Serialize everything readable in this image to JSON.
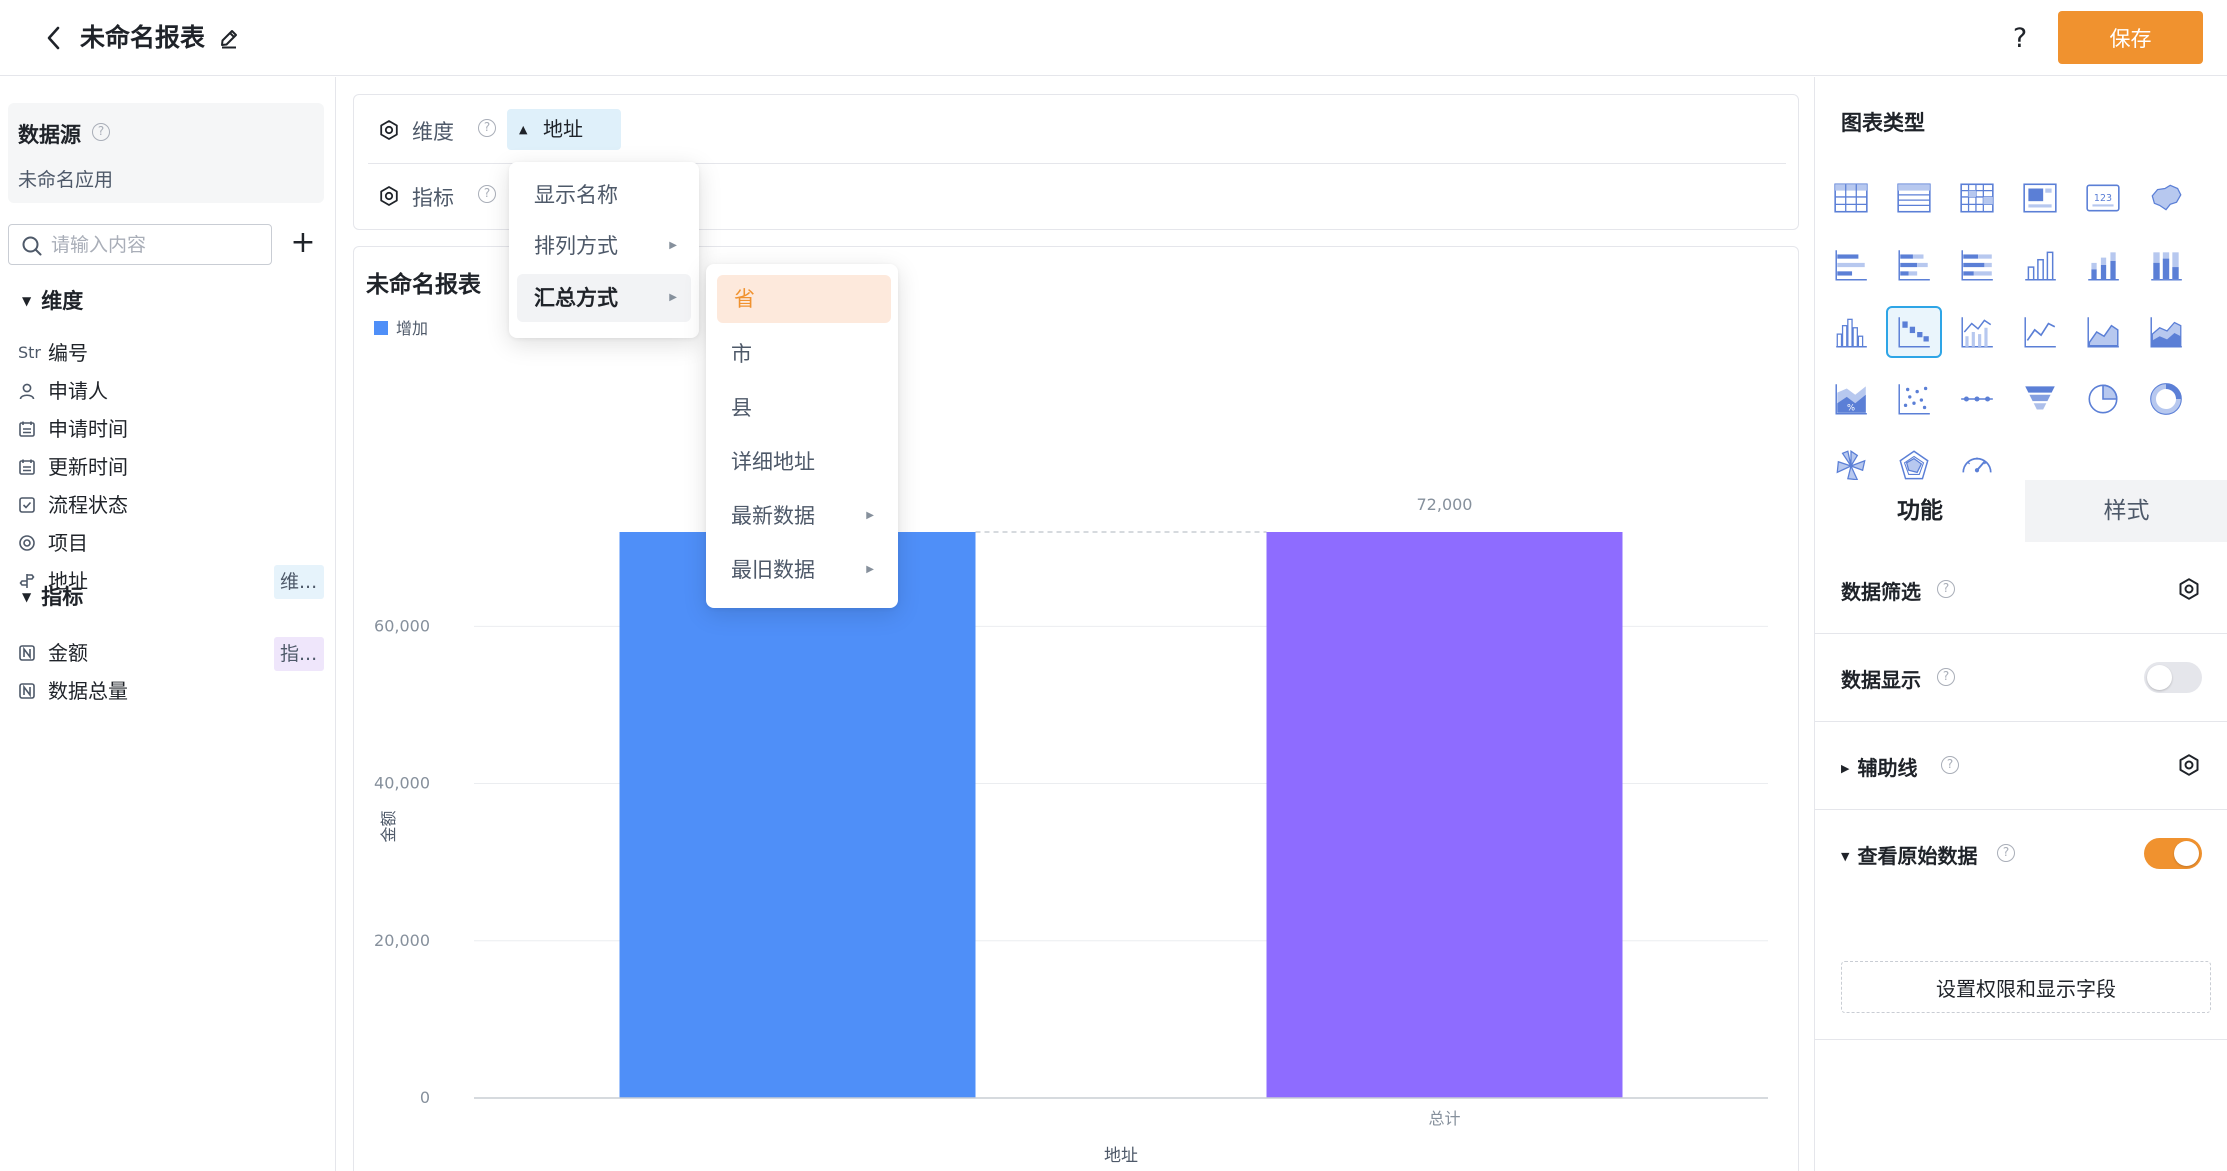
{
  "header": {
    "title": "未命名报表",
    "help_label": "?",
    "save_label": "保存"
  },
  "sidebar": {
    "datasource_title": "数据源",
    "datasource_app": "未命名应用",
    "search_placeholder": "请输入内容",
    "add_label": "+",
    "dimension_section": "维度",
    "dimension_fields": [
      {
        "icon": "Str",
        "label": "编号"
      },
      {
        "icon": "user-icon",
        "label": "申请人"
      },
      {
        "icon": "calendar-icon",
        "label": "申请时间"
      },
      {
        "icon": "calendar-icon",
        "label": "更新时间"
      },
      {
        "icon": "checkbox-icon",
        "label": "流程状态"
      },
      {
        "icon": "radio-icon",
        "label": "项目"
      },
      {
        "icon": "location-icon",
        "label": "地址",
        "tag": "维..."
      }
    ],
    "metric_section": "指标",
    "metric_fields": [
      {
        "icon": "number-icon",
        "label": "金额",
        "tag": "指..."
      },
      {
        "icon": "number-icon",
        "label": "数据总量"
      }
    ]
  },
  "config": {
    "dimension_label": "维度",
    "metric_label": "指标",
    "dimension_chip": "地址"
  },
  "menus": {
    "field_menu": [
      {
        "label": "显示名称",
        "has_submenu": false
      },
      {
        "label": "排列方式",
        "has_submenu": true
      },
      {
        "label": "汇总方式",
        "has_submenu": true,
        "active": true
      }
    ],
    "summary_menu": [
      {
        "label": "省",
        "selected": true
      },
      {
        "label": "市"
      },
      {
        "label": "县"
      },
      {
        "label": "详细地址"
      },
      {
        "label": "最新数据",
        "has_submenu": true
      },
      {
        "label": "最旧数据",
        "has_submenu": true
      }
    ]
  },
  "chart_card": {
    "title": "未命名报表",
    "legend_label": "增加"
  },
  "chart_data": {
    "type": "bar",
    "subtype": "waterfall",
    "categories": [
      "",
      "总计"
    ],
    "values": [
      72000,
      72000
    ],
    "data_labels": [
      "",
      "72,000"
    ],
    "colors": [
      "#4f8ff8",
      "#8e6cff"
    ],
    "xlabel": "地址",
    "ylabel": "金额",
    "ylim": [
      0,
      72000
    ],
    "yticks": [
      0,
      20000,
      40000,
      60000
    ],
    "ytick_labels": [
      "0",
      "20,000",
      "40,000",
      "60,000"
    ],
    "grid": true,
    "legend": [
      "增加"
    ],
    "legend_position": "top-left"
  },
  "right_panel": {
    "chart_types_title": "图表类型",
    "chart_types": [
      "table-icon",
      "detail-table-icon",
      "pivot-table-icon",
      "card-icon",
      "indicator-card-icon",
      "map-icon",
      "bar-h-icon",
      "stacked-bar-h-icon",
      "percent-bar-h-icon",
      "column-icon",
      "stacked-column-icon",
      "percent-column-icon",
      "histogram-icon",
      "waterfall-icon",
      "combo-icon",
      "line-icon",
      "area-icon",
      "stacked-area-icon",
      "percent-area-icon",
      "scatter-icon",
      "dot-line-icon",
      "funnel-icon",
      "pie-icon",
      "donut-icon",
      "rose-icon",
      "radar-icon",
      "gauge-icon"
    ],
    "active_chart_type": 13,
    "tab_function": "功能",
    "tab_style": "样式",
    "data_filter_label": "数据筛选",
    "data_display_label": "数据显示",
    "data_display_on": false,
    "guide_line_label": "辅助线",
    "raw_data_label": "查看原始数据",
    "raw_data_on": true,
    "permission_button": "设置权限和显示字段",
    "accent_color": "#f0922f",
    "selected_color": "#2ea5e6"
  }
}
